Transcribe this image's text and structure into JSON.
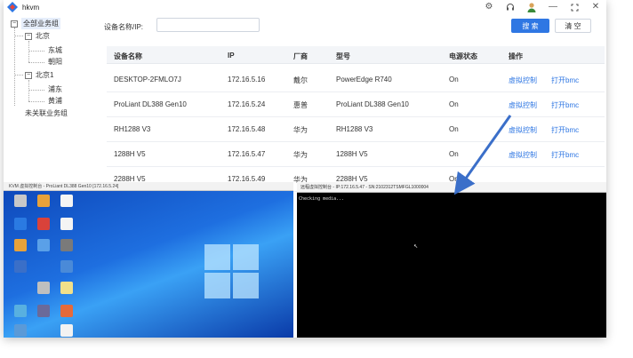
{
  "app": {
    "title": "hkvm"
  },
  "titlebar": {
    "icons": [
      "gear-icon",
      "headset-icon",
      "avatar",
      "minimize-icon",
      "maximize-icon",
      "close-icon"
    ]
  },
  "tree": {
    "root": "全部业务组",
    "groups": [
      {
        "label": "北京",
        "children": [
          "东城",
          "朝阳"
        ]
      },
      {
        "label": "北京1",
        "children": [
          "浦东",
          "黄浦"
        ]
      }
    ],
    "ungrouped": "未关联业务组"
  },
  "search": {
    "label": "设备名称/IP:",
    "value": "",
    "placeholder": "",
    "search_button": "搜 索",
    "clear_button": "清 空"
  },
  "table": {
    "headers": [
      "设备名称",
      "IP",
      "厂商",
      "型号",
      "电源状态",
      "操作"
    ],
    "rows": [
      {
        "name": "DESKTOP-2FMLO7J",
        "ip": "172.16.5.16",
        "vendor": "戴尔",
        "model": "PowerEdge R740",
        "power": "On",
        "action1": "虚拟控制",
        "action2": "打开bmc"
      },
      {
        "name": "ProLiant DL388 Gen10",
        "ip": "172.16.5.24",
        "vendor": "惠普",
        "model": "ProLiant DL388 Gen10",
        "power": "On",
        "action1": "虚拟控制",
        "action2": "打开bmc"
      },
      {
        "name": "RH1288 V3",
        "ip": "172.16.5.48",
        "vendor": "华为",
        "model": "RH1288 V3",
        "power": "On",
        "action1": "虚拟控制",
        "action2": "打开bmc"
      },
      {
        "name": "1288H V5",
        "ip": "172.16.5.47",
        "vendor": "华为",
        "model": "1288H V5",
        "power": "On",
        "action1": "虚拟控制",
        "action2": "打开bmc"
      },
      {
        "name": "2288H V5",
        "ip": "172.16.5.49",
        "vendor": "华为",
        "model": "2288H V5",
        "power": "On",
        "action1": "",
        "action2": ""
      }
    ]
  },
  "remote_left": {
    "title": "KVM 虚拟控制台 - ProLiant DL388 Gen10 [172.16.5.24]"
  },
  "remote_right": {
    "title": "远程虚拟控制台 - IP:172.16.5.47 - SN:2102312TSMFGL1000004",
    "console": "Checking media..."
  },
  "colors": {
    "accent": "#2f77e3",
    "link": "#2f77e3",
    "header_bg": "#f3f5f8",
    "arrow": "#3b6fc9"
  }
}
